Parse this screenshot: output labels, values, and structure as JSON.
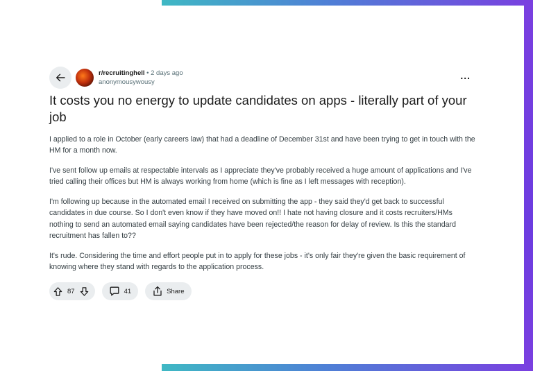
{
  "post": {
    "subreddit": "r/recruitinghell",
    "separator": "•",
    "time_ago": "2 days ago",
    "username": "anonymousywousy",
    "title": "It costs you no energy to update candidates on apps - literally part of your job",
    "paragraphs": [
      "I applied to a role in October (early careers law) that had a deadline of December 31st and have been trying to get in touch with the HM for a month now.",
      "I've sent follow up emails at respectable intervals as I appreciate they've probably received a huge amount of applications and I've tried calling their offices but HM is always working from home (which is fine as I left messages with reception).",
      "I'm following up because in the automated email I received on submitting the app - they said they'd get back to successful candidates in due course. So I don't even know if they have moved on!! I hate not having closure and it costs recruiters/HMs nothing to send an automated email saying candidates have been rejected/the reason for delay of review. Is this the standard recruitment has fallen to??",
      "It's rude. Considering the time and effort people put in to apply for these jobs - it's only fair they're given the basic requirement of knowing where they stand with regards to the application process."
    ],
    "more_label": "..."
  },
  "actions": {
    "votes": "87",
    "comments": "41",
    "share_label": "Share"
  },
  "icons": {
    "back": "arrow-left-icon",
    "upvote": "arrow-up-icon",
    "downvote": "arrow-down-icon",
    "comment": "speech-bubble-icon",
    "share": "share-icon",
    "more": "ellipsis-icon"
  },
  "colors": {
    "pill_bg": "#eaedef",
    "meta_gray": "#576f76",
    "frame_teal": "#3fb8c4",
    "frame_purple": "#7a3fe0"
  }
}
